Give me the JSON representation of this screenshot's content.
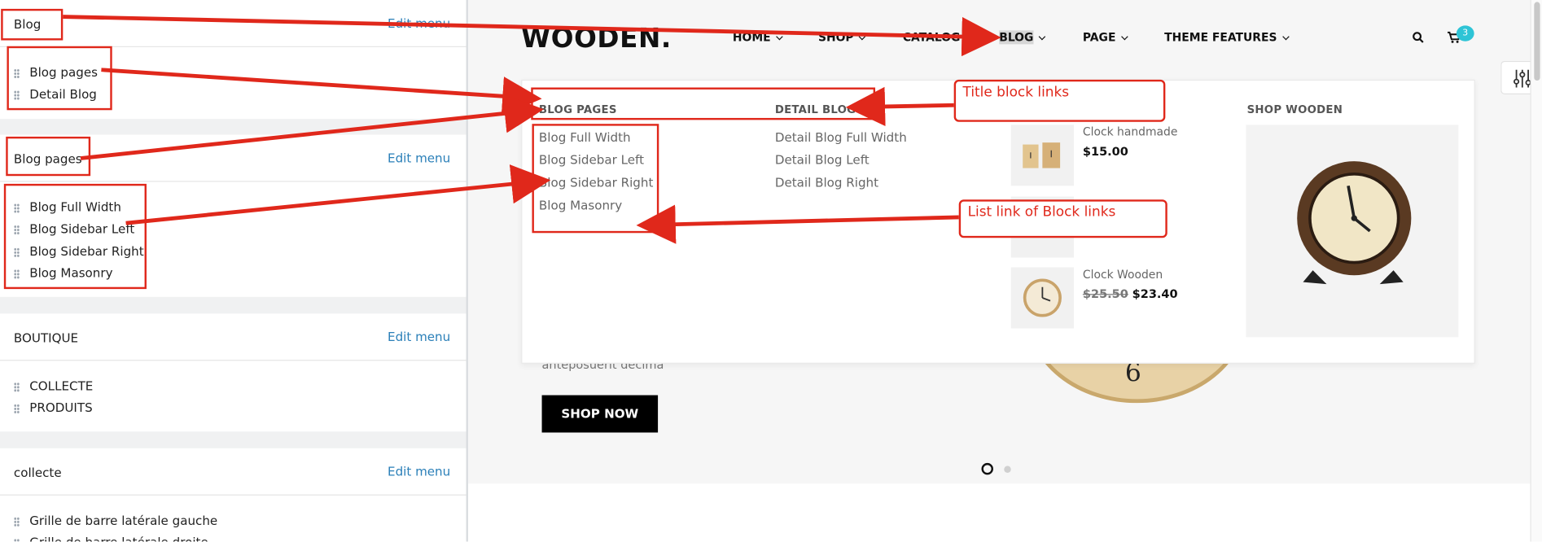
{
  "admin": {
    "cards": [
      {
        "title": "Blog",
        "edit_label": "Edit menu",
        "items": [
          "Blog pages",
          "Detail Blog"
        ]
      },
      {
        "title": "Blog pages",
        "edit_label": "Edit menu",
        "items": [
          "Blog Full Width",
          "Blog Sidebar Left",
          "Blog Sidebar Right",
          "Blog Masonry"
        ]
      },
      {
        "title": "BOUTIQUE",
        "edit_label": "Edit menu",
        "items": [
          "COLLECTE",
          "PRODUITS"
        ]
      },
      {
        "title": "collecte",
        "edit_label": "Edit menu",
        "items": [
          "Grille de barre latérale gauche",
          "Grille de barre latérale droite"
        ]
      }
    ]
  },
  "store": {
    "logo": "WOODEN.",
    "nav": [
      "HOME",
      "SHOP",
      "CATALOG",
      "BLOG",
      "PAGE",
      "THEME FEATURES"
    ],
    "cart_count": "3",
    "mega_menu": {
      "blog_pages": {
        "title": "BLOG PAGES",
        "links": [
          "Blog Full Width",
          "Blog Sidebar Left",
          "Blog Sidebar Right",
          "Blog Masonry"
        ]
      },
      "detail_blog": {
        "title": "DETAIL BLOG",
        "links": [
          "Detail Blog Full Width",
          "Detail Blog Left",
          "Detail Blog Right"
        ]
      },
      "products": [
        {
          "name": "Clock handmade",
          "price": "$15.00"
        },
        {
          "name": "Clock Wooden",
          "old_price": "$25.50",
          "price": "$23.40"
        }
      ],
      "featured_title": "SHOP WOODEN"
    },
    "hero": {
      "text": "anteposuerit decima",
      "button": "SHOP NOW"
    }
  },
  "annotations": {
    "title_block": "Title block links",
    "list_block": "List link of Block links"
  },
  "colors": {
    "annotation": "#e0281b",
    "link": "#2a7fb8",
    "badge": "#2ec4d6"
  }
}
